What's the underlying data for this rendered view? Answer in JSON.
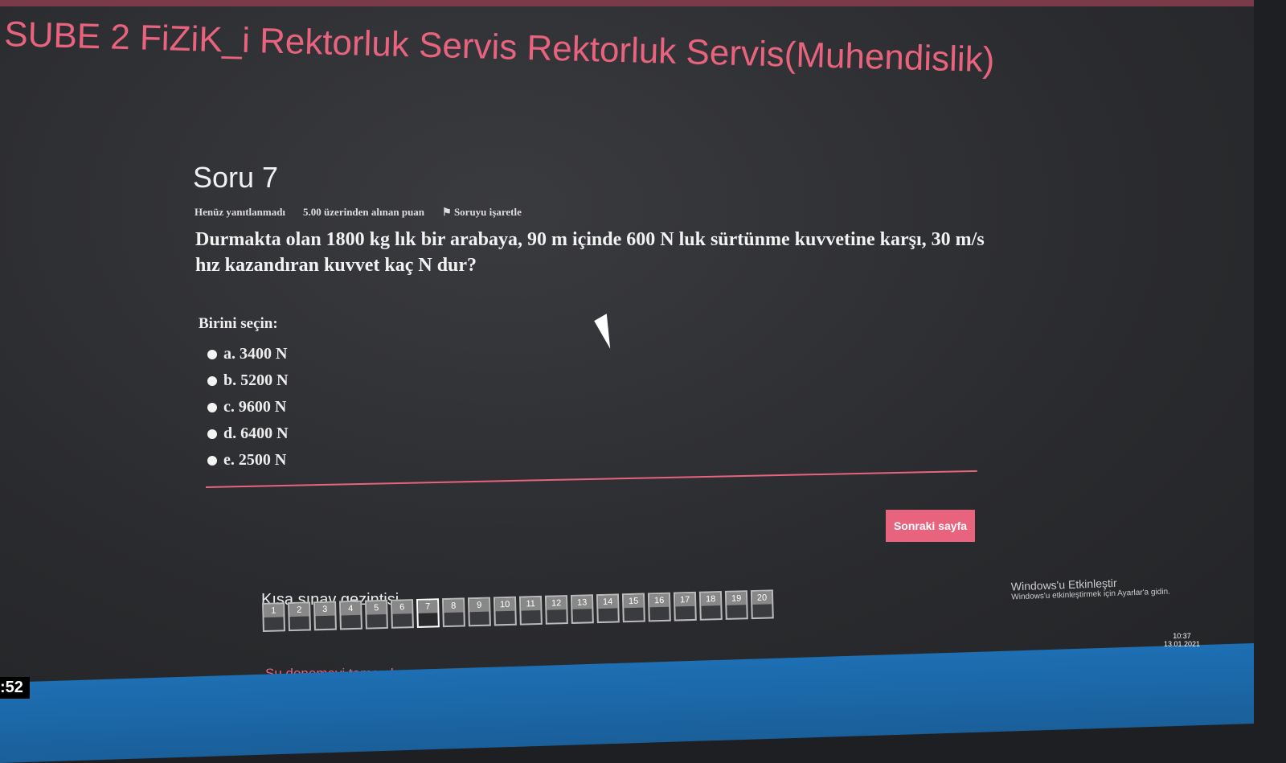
{
  "header": {
    "title": "SUBE 2 FiZiK_i Rektorluk Servis Rektorluk Servis(Muhendislik)"
  },
  "question": {
    "title": "Soru 7",
    "status": "Henüz yanıtlanmadı",
    "grade": "5.00 üzerinden alınan puan",
    "flag": "Soruyu işaretle",
    "text": "Durmakta olan 1800 kg lık bir arabaya, 90 m içinde 600 N luk sürtünme kuvvetine karşı, 30 m/s hız kazandıran kuvvet kaç N dur?",
    "prompt": "Birini seçin:",
    "options": [
      "a. 3400 N",
      "b. 5200 N",
      "c. 9600 N",
      "d. 6400 N",
      "e. 2500 N"
    ]
  },
  "next_label": "Sonraki sayfa",
  "nav": {
    "title": "Kısa sınav gezintisi",
    "pages": [
      "1",
      "2",
      "3",
      "4",
      "5",
      "6",
      "7",
      "8",
      "9",
      "10",
      "11",
      "12",
      "13",
      "14",
      "15",
      "16",
      "17",
      "18",
      "19",
      "20"
    ],
    "current": "7",
    "finish": "Şu denemeyi tamamla: ..."
  },
  "watermark": {
    "title": "Windows'u Etkinleştir",
    "subtitle": "Windows'u etkinleştirmek için Ayarlar'a gidin."
  },
  "tray": {
    "time": "10:37",
    "date": "13.01.2021"
  },
  "overlay_time": ":52",
  "colors": {
    "accent": "#e8637d"
  }
}
